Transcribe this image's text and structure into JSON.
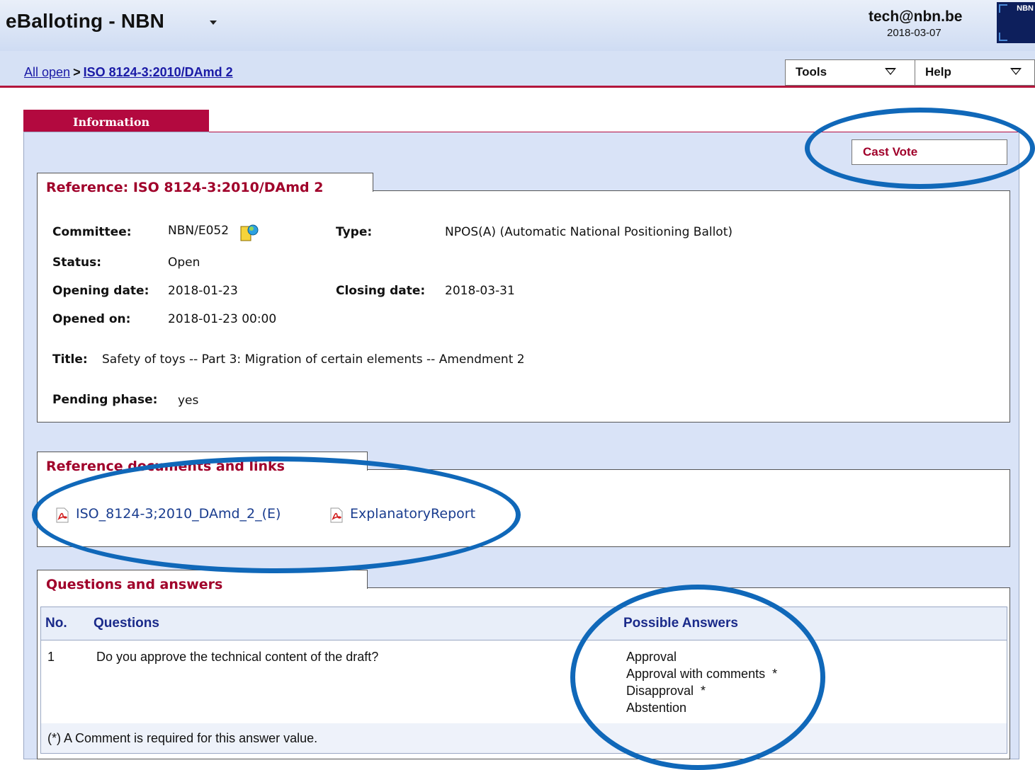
{
  "header": {
    "app_title": "eBalloting - NBN",
    "user_email": "tech@nbn.be",
    "user_date": "2018-03-07",
    "logo_text": "NBN"
  },
  "breadcrumb": {
    "root": "All open",
    "separator": ">",
    "current": "ISO 8124-3:2010/DAmd 2"
  },
  "menus": {
    "tools": "Tools",
    "help": "Help"
  },
  "tabs": {
    "information": "Information"
  },
  "actions": {
    "cast_vote": "Cast Vote"
  },
  "reference": {
    "title": "Reference: ISO 8124-3:2010/DAmd 2",
    "committee_label": "Committee:",
    "committee_value": "NBN/E052",
    "type_label": "Type:",
    "type_value": "NPOS(A)  (Automatic National Positioning Ballot)",
    "status_label": "Status:",
    "status_value": "Open",
    "opening_label": "Opening date:",
    "opening_value": "2018-01-23",
    "closing_label": "Closing date:",
    "closing_value": "2018-03-31",
    "opened_on_label": "Opened on:",
    "opened_on_value": "2018-01-23 00:00",
    "doc_title_label": "Title:",
    "doc_title_value": "Safety of toys -- Part 3: Migration of certain elements -- Amendment 2",
    "pending_label": "Pending phase:",
    "pending_value": "yes"
  },
  "documents": {
    "title": "Reference documents and links",
    "items": [
      {
        "label": "ISO_8124-3;2010_DAmd_2_(E)",
        "icon": "pdf-icon"
      },
      {
        "label": "ExplanatoryReport",
        "icon": "pdf-icon"
      }
    ]
  },
  "qa": {
    "title": "Questions and answers",
    "columns": {
      "no": "No.",
      "questions": "Questions",
      "answers": "Possible Answers"
    },
    "rows": [
      {
        "no": "1",
        "question": "Do you approve the technical content of the draft?",
        "answers": [
          "Approval",
          "Approval with comments  *",
          "Disapproval  *",
          "Abstention"
        ]
      }
    ],
    "footnote": "(*) A Comment is required for this answer value."
  },
  "colors": {
    "accent": "#b3093f",
    "panel": "#d9e3f7",
    "annotation": "#1068b9"
  }
}
